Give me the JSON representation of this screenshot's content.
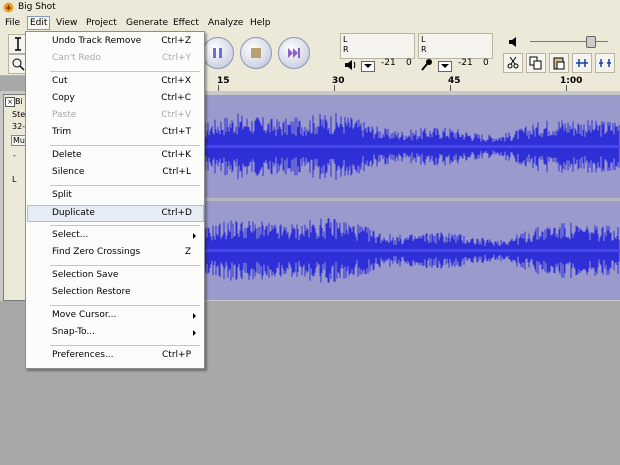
{
  "window": {
    "title": "Big Shot"
  },
  "menubar": {
    "items": [
      {
        "label": "File"
      },
      {
        "label": "Edit"
      },
      {
        "label": "View"
      },
      {
        "label": "Project"
      },
      {
        "label": "Generate"
      },
      {
        "label": "Effect"
      },
      {
        "label": "Analyze"
      },
      {
        "label": "Help"
      }
    ]
  },
  "toolbar": {
    "meter_left": "L",
    "meter_right": "R",
    "meter_left2": "L",
    "meter_right2": "R",
    "play_meter_value": "-21",
    "play_meter_zero": "0",
    "rec_meter_value": "-21",
    "rec_meter_zero": "0",
    "play_icon": "speaker-icon",
    "rec_icon": "microphone-icon"
  },
  "ruler": {
    "ticks": [
      "15",
      "30",
      "45",
      "1:00"
    ]
  },
  "track": {
    "name_abbr": "Bi",
    "line1": "Ste",
    "line2": "32-",
    "mute": "Mu",
    "dash": "-",
    "left": "L"
  },
  "edit_menu": {
    "items": [
      {
        "label": "Undo Track Remove",
        "shortcut": "Ctrl+Z",
        "enabled": true
      },
      {
        "label": "Can't Redo",
        "shortcut": "Ctrl+Y",
        "enabled": false
      },
      {
        "label": "Cut",
        "shortcut": "Ctrl+X",
        "enabled": true
      },
      {
        "label": "Copy",
        "shortcut": "Ctrl+C",
        "enabled": true
      },
      {
        "label": "Paste",
        "shortcut": "Ctrl+V",
        "enabled": false
      },
      {
        "label": "Trim",
        "shortcut": "Ctrl+T",
        "enabled": true
      },
      {
        "label": "Delete",
        "shortcut": "Ctrl+K",
        "enabled": true
      },
      {
        "label": "Silence",
        "shortcut": "Ctrl+L",
        "enabled": true
      },
      {
        "label": "Split",
        "shortcut": "",
        "enabled": true
      },
      {
        "label": "Duplicate",
        "shortcut": "Ctrl+D",
        "enabled": true,
        "highlighted": true
      },
      {
        "label": "Select...",
        "shortcut": "",
        "enabled": true,
        "submenu": true
      },
      {
        "label": "Find Zero Crossings",
        "shortcut": "Z",
        "enabled": true
      },
      {
        "label": "Selection Save",
        "shortcut": "",
        "enabled": true
      },
      {
        "label": "Selection Restore",
        "shortcut": "",
        "enabled": true
      },
      {
        "label": "Move Cursor...",
        "shortcut": "",
        "enabled": true,
        "submenu": true
      },
      {
        "label": "Snap-To...",
        "shortcut": "",
        "enabled": true,
        "submenu": true
      },
      {
        "label": "Preferences...",
        "shortcut": "Ctrl+P",
        "enabled": true
      }
    ]
  },
  "colors": {
    "waveform": "#2f2fd8",
    "wave_bg": "#9a9acc",
    "menu_highlight": "#e5ecf6"
  }
}
